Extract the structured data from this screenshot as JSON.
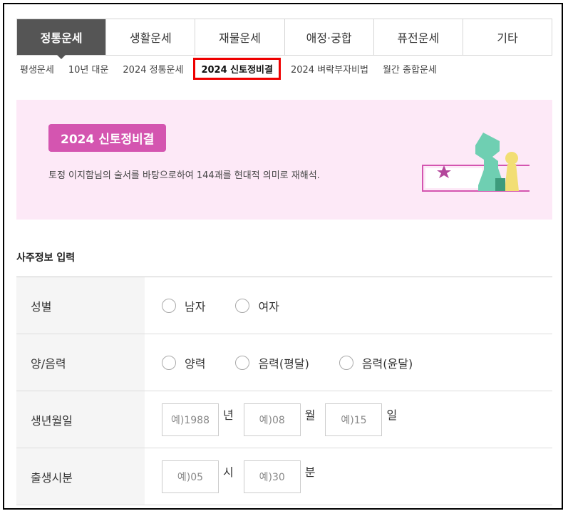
{
  "tabs": [
    "정통운세",
    "생활운세",
    "재물운세",
    "애정·궁합",
    "퓨전운세",
    "기타"
  ],
  "subnav": [
    "평생운세",
    "10년 대운",
    "2024 정통운세",
    "2024 신토정비결",
    "2024 벼락부자비법",
    "월간 종합운세"
  ],
  "banner": {
    "title": "2024 신토정비결",
    "desc": "토정 이지함님의 술서를 바탕으로하여 144괘를 현대적 의미로 재해석."
  },
  "form": {
    "section_title": "사주정보 입력",
    "gender": {
      "label": "성별",
      "options": [
        "남자",
        "여자"
      ]
    },
    "calendar": {
      "label": "양/음력",
      "options": [
        "양력",
        "음력(평달)",
        "음력(윤달)"
      ]
    },
    "birth": {
      "label": "생년월일",
      "year_ph": "예)1988",
      "year_unit": "년",
      "month_ph": "예)08",
      "month_unit": "월",
      "day_ph": "예)15",
      "day_unit": "일"
    },
    "time": {
      "label": "출생시분",
      "hour_ph": "예)05",
      "hour_unit": "시",
      "min_ph": "예)30",
      "min_unit": "분"
    }
  },
  "colors": {
    "banner_bg": "#fde9f7",
    "badge": "#d455b0",
    "tab_active": "#555555",
    "highlight": "#e00000"
  }
}
